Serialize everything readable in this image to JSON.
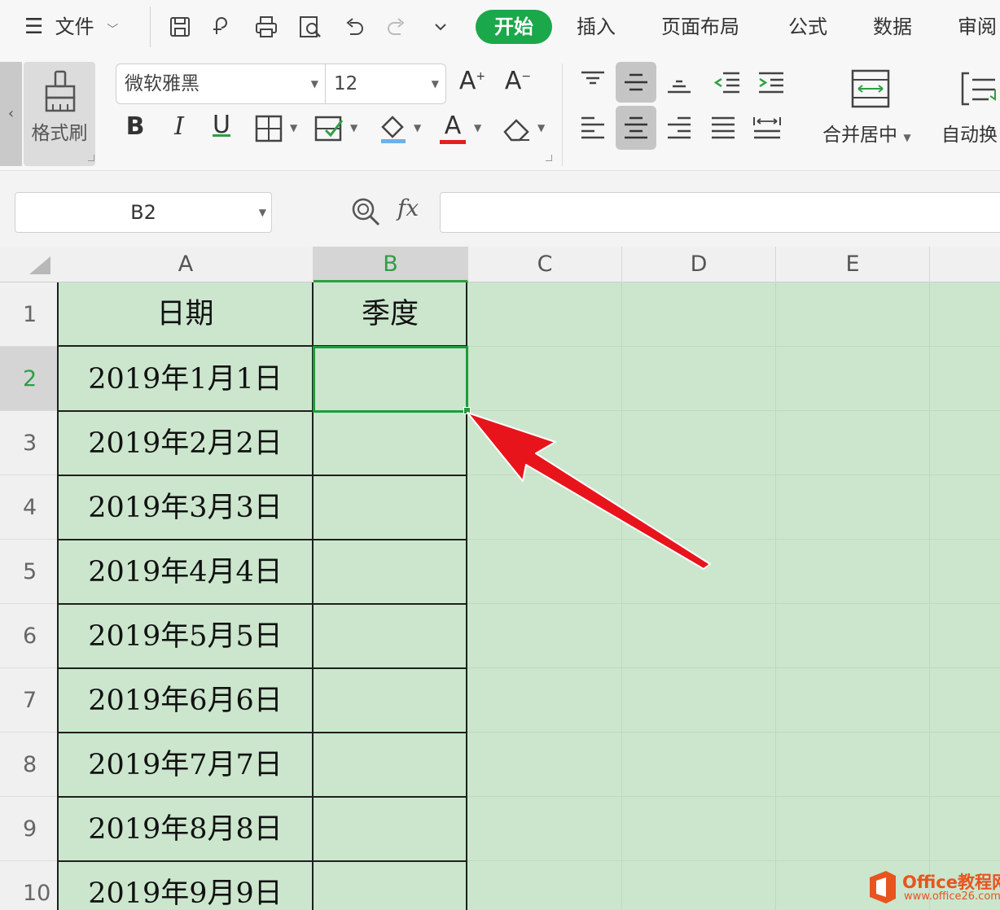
{
  "menu": {
    "file_label": "文件",
    "tabs": [
      "开始",
      "插入",
      "页面布局",
      "公式",
      "数据",
      "审阅"
    ],
    "active_tab": "开始"
  },
  "ribbon": {
    "format_painter_label": "格式刷",
    "font_name": "微软雅黑",
    "font_size": "12",
    "merge_center_label": "合并居中",
    "auto_wrap_label": "自动换",
    "grow_font": "A",
    "shrink_font": "A",
    "bold": "B",
    "italic": "I",
    "underline": "U",
    "font_color_glyph": "A",
    "font_color": "#e02020",
    "fill_color": "#6fb0e6"
  },
  "formula_bar": {
    "name_box": "B2",
    "fx_label": "fx",
    "formula": ""
  },
  "sheet": {
    "columns": [
      "A",
      "B",
      "C",
      "D",
      "E"
    ],
    "selected_column": "B",
    "rows": [
      "1",
      "2",
      "3",
      "4",
      "5",
      "6",
      "7",
      "8",
      "9",
      "10"
    ],
    "selected_row": "2",
    "header": {
      "date": "日期",
      "quarter": "季度"
    },
    "dates": [
      "2019年1月1日",
      "2019年2月2日",
      "2019年3月3日",
      "2019年4月4日",
      "2019年5月5日",
      "2019年6月6日",
      "2019年7月7日",
      "2019年8月8日",
      "2019年9月9日"
    ],
    "selected_cell": "B2",
    "sheet_color": "#cbe6cd",
    "selection_color": "#1e9b3a"
  },
  "annotation": {
    "arrow_color": "#e8141c"
  },
  "watermark": {
    "line1": "Office教程网",
    "line2": "www.office26.com"
  }
}
